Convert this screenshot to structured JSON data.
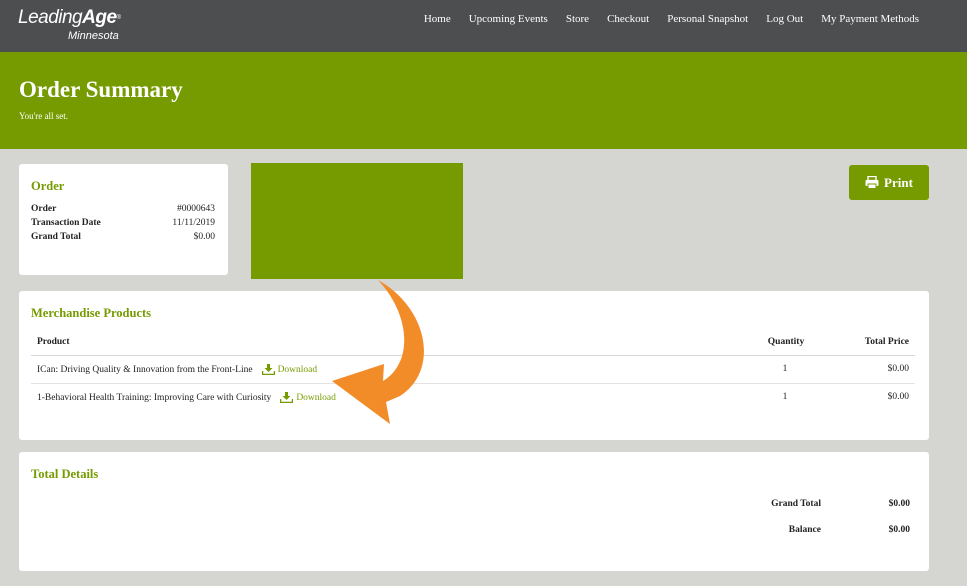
{
  "logo": {
    "main_light": "Leading",
    "main_bold": "Age",
    "reg": "®",
    "sub": "Minnesota"
  },
  "nav": [
    {
      "label": "Home"
    },
    {
      "label": "Upcoming Events"
    },
    {
      "label": "Store"
    },
    {
      "label": "Checkout"
    },
    {
      "label": "Personal Snapshot"
    },
    {
      "label": "Log Out"
    },
    {
      "label": "My Payment Methods"
    }
  ],
  "hero": {
    "title": "Order Summary",
    "subtitle": "You're all set."
  },
  "order": {
    "title": "Order",
    "rows": [
      {
        "label": "Order",
        "value": "#0000643"
      },
      {
        "label": "Transaction Date",
        "value": "11/11/2019"
      },
      {
        "label": "Grand Total",
        "value": "$0.00"
      }
    ]
  },
  "print_label": "Print",
  "merchandise": {
    "title": "Merchandise Products",
    "columns": {
      "product": "Product",
      "quantity": "Quantity",
      "total": "Total Price"
    },
    "rows": [
      {
        "product": "ICan: Driving Quality & Innovation from the Front-Line",
        "download": "Download",
        "quantity": "1",
        "price": "$0.00"
      },
      {
        "product": "1-Behavioral Health Training: Improving Care with Curiosity",
        "download": "Download",
        "quantity": "1",
        "price": "$0.00"
      }
    ]
  },
  "totals": {
    "title": "Total Details",
    "grand_label": "Grand Total",
    "grand_value": "$0.00",
    "balance_label": "Balance",
    "balance_value": "$0.00"
  },
  "colors": {
    "brand_green": "#759b00",
    "nav_bg": "#4d4e50",
    "page_bg": "#d5d6d1",
    "arrow": "#f28c28"
  }
}
